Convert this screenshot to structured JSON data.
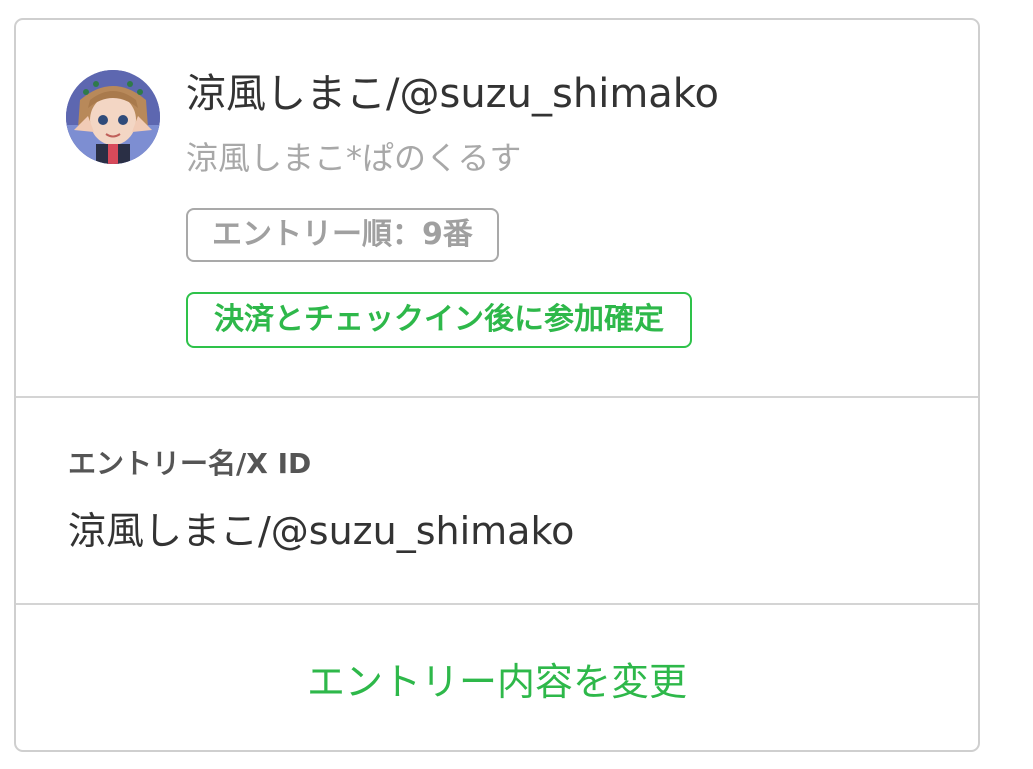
{
  "entry_card": {
    "user": {
      "display_name": "涼風しまこ/@suzu_shimako",
      "sub_name": "涼風しまこ*ぱのくるす",
      "avatar_icon": "user-avatar-icon"
    },
    "badges": {
      "entry_order": "エントリー順：9番",
      "status": "決済とチェックイン後に参加確定"
    },
    "field": {
      "label": "エントリー名/X ID",
      "value": "涼風しまこ/@suzu_shimako"
    },
    "actions": {
      "change_entry": "エントリー内容を変更"
    }
  },
  "colors": {
    "accent_green": "#2eb84a",
    "muted_gray": "#a8a8a8",
    "border_gray": "#cfcfcf"
  }
}
